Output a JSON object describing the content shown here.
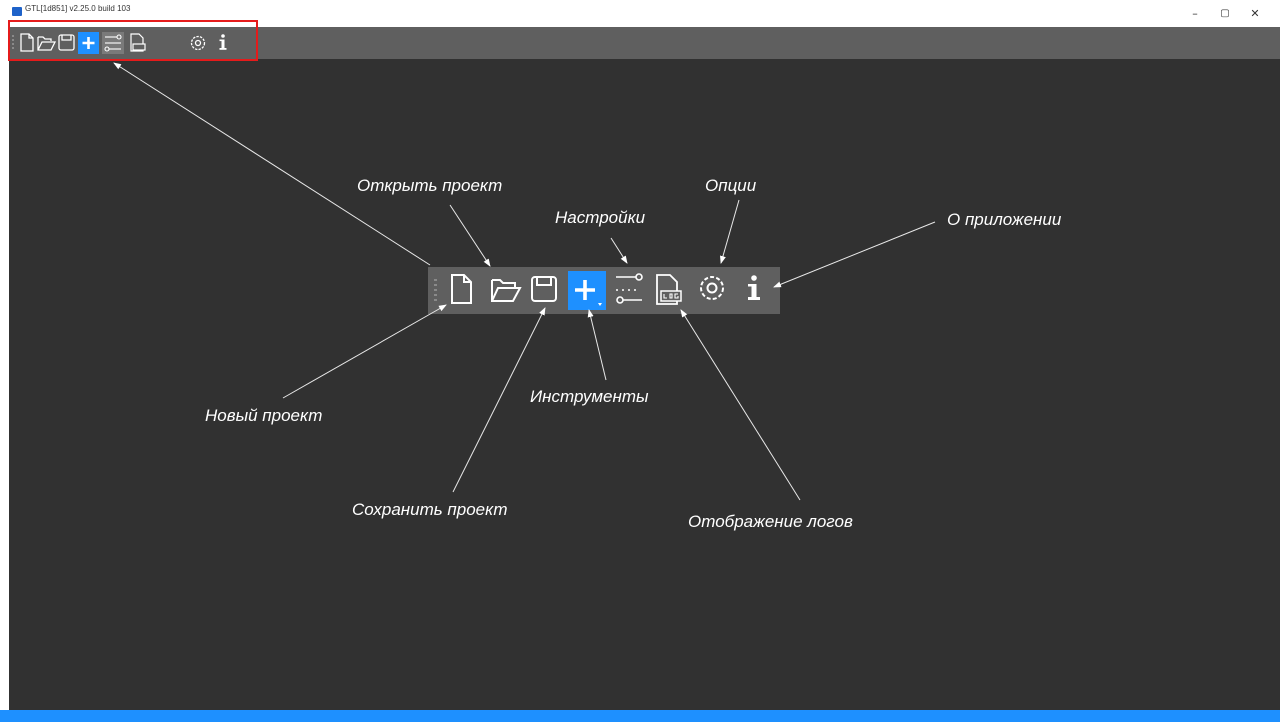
{
  "window": {
    "title": "GTL[1d851] v2.25.0 build 103",
    "controls": {
      "minimize": "–",
      "maximize": "▢",
      "close": "✕"
    }
  },
  "toolbar": {
    "items": [
      {
        "id": "new-project",
        "icon": "new-file-icon"
      },
      {
        "id": "open-project",
        "icon": "open-folder-icon"
      },
      {
        "id": "save-project",
        "icon": "save-icon"
      },
      {
        "id": "tools",
        "icon": "plus-icon"
      },
      {
        "id": "settings",
        "icon": "sliders-icon"
      },
      {
        "id": "logs",
        "icon": "log-file-icon"
      },
      {
        "id": "options",
        "icon": "gear-icon"
      },
      {
        "id": "about",
        "icon": "info-icon"
      }
    ]
  },
  "callouts": {
    "new_project": "Новый проект",
    "open_project": "Открыть проект",
    "save_project": "Сохранить проект",
    "tools": "Инструменты",
    "settings": "Настройки",
    "logs": "Отображение логов",
    "options": "Опции",
    "about": "О приложении"
  },
  "colors": {
    "workspace": "#313131",
    "toolbar": "#5f5f5f",
    "accent": "#1e90ff",
    "highlight": "#e51b1b"
  }
}
